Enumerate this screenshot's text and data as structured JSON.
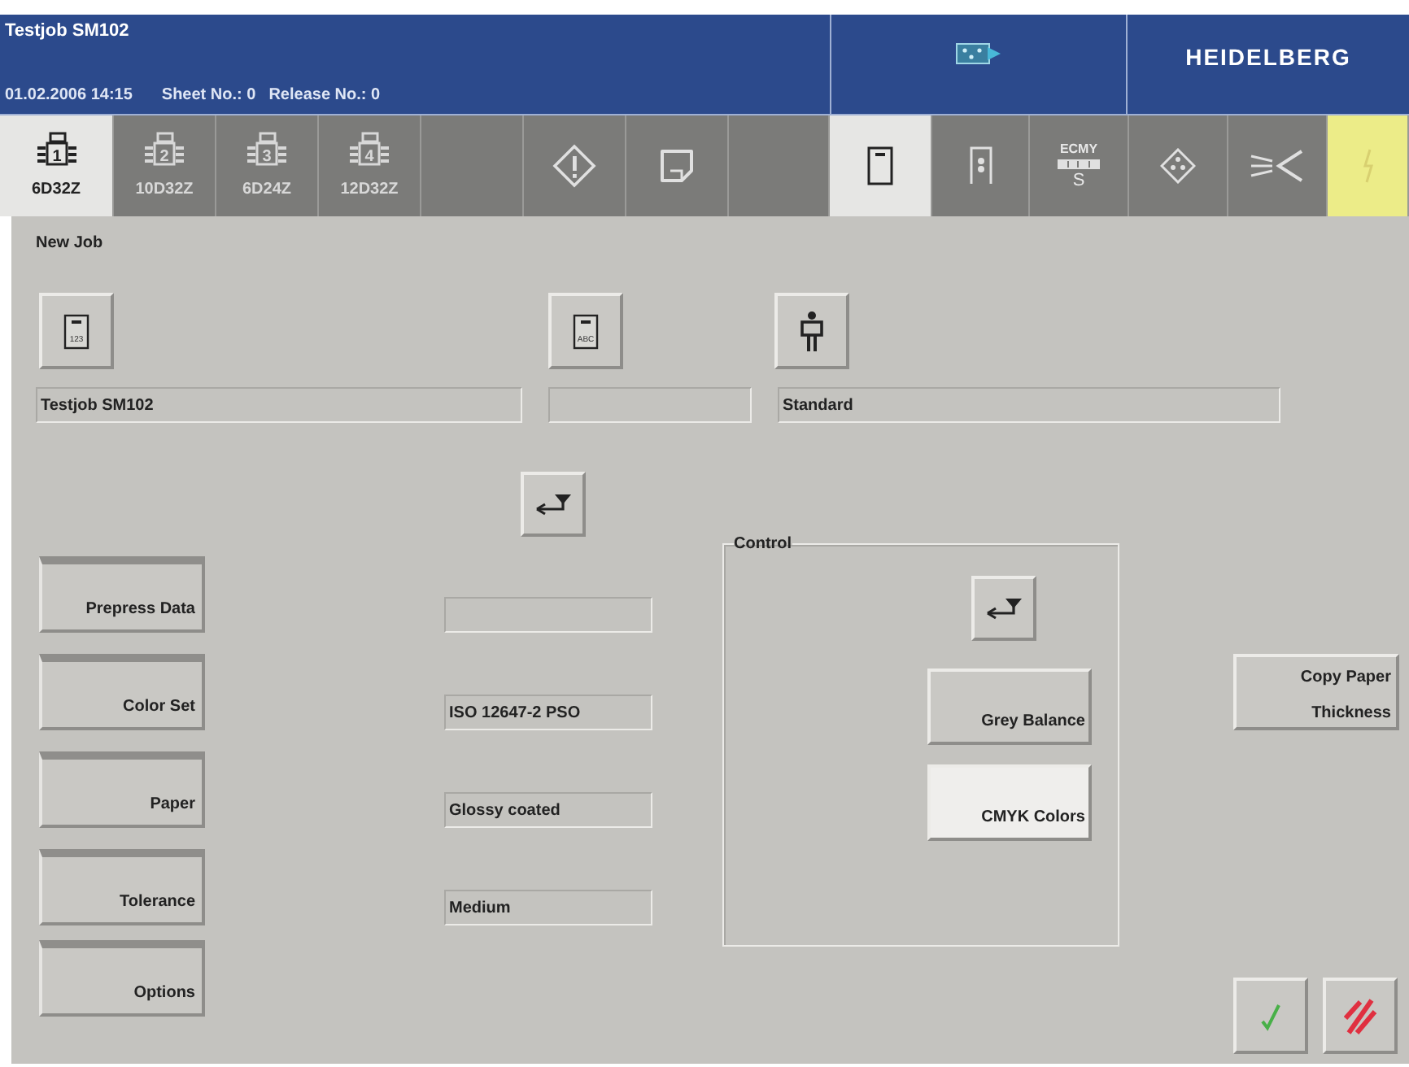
{
  "header": {
    "title": "Testjob SM102",
    "datetime": "01.02.2006 14:15",
    "sheet": "Sheet No.: 0",
    "release": "Release No.: 0",
    "logo": "HEIDELBERG"
  },
  "toolbar": [
    {
      "kind": "unit",
      "number": "1",
      "label": "6D32Z",
      "selected": true
    },
    {
      "kind": "unit",
      "number": "2",
      "label": "10D32Z",
      "selected": false
    },
    {
      "kind": "unit",
      "number": "3",
      "label": "6D24Z",
      "selected": false
    },
    {
      "kind": "unit",
      "number": "4",
      "label": "12D32Z",
      "selected": false
    },
    {
      "kind": "blank"
    },
    {
      "kind": "warning",
      "selected": false
    },
    {
      "kind": "sheet",
      "selected": false
    },
    {
      "kind": "blank"
    },
    {
      "kind": "document",
      "selected": true
    },
    {
      "kind": "register",
      "selected": false
    },
    {
      "kind": "cmyk",
      "top": "ECMY",
      "bottom": "S",
      "selected": false
    },
    {
      "kind": "diamond",
      "selected": false
    },
    {
      "kind": "light",
      "selected": false
    },
    {
      "kind": "flash",
      "selected": false
    }
  ],
  "job": {
    "title": "New Job",
    "number_icon_text": "123",
    "name_icon_text": "ABC",
    "name": "Testjob SM102",
    "profile": "Standard"
  },
  "settings": [
    {
      "label": "Prepress Data"
    },
    {
      "label": "Color Set",
      "value": "ISO 12647-2 PSO"
    },
    {
      "label": "Paper",
      "value": "Glossy coated"
    },
    {
      "label": "Tolerance",
      "value": "Medium"
    },
    {
      "label": "Options"
    }
  ],
  "control": {
    "title": "Control",
    "modes": [
      {
        "label": "Grey Balance",
        "selected": false
      },
      {
        "label": "CMYK Colors",
        "selected": true
      }
    ]
  },
  "copy_button": "Copy Paper Thickness"
}
